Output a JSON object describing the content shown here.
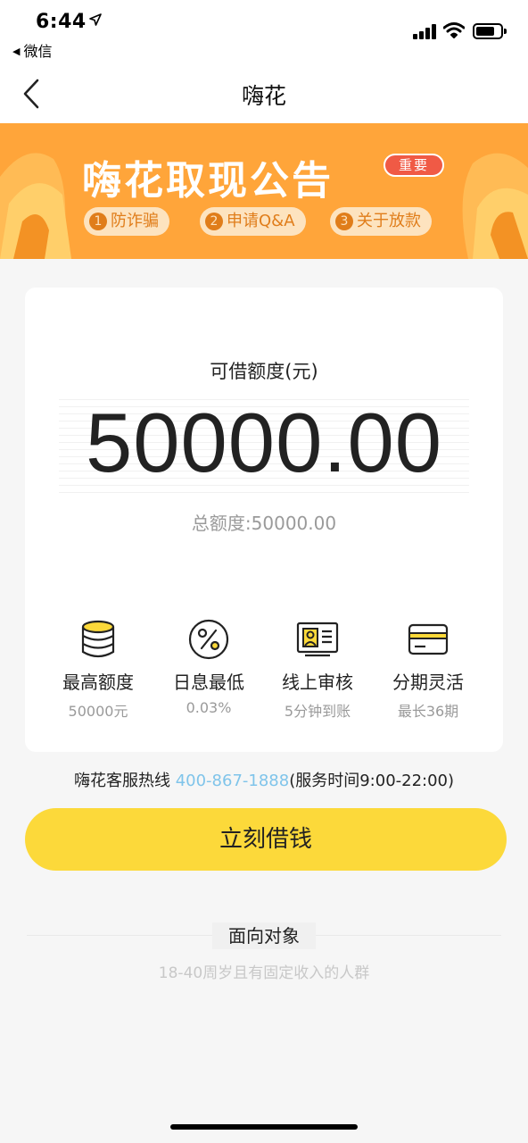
{
  "status_bar": {
    "time": "6:44",
    "back_app": "微信"
  },
  "nav": {
    "title": "嗨花"
  },
  "banner": {
    "title": "嗨花取现公告",
    "badge": "重要",
    "pills": [
      {
        "num": "1",
        "label": "防诈骗"
      },
      {
        "num": "2",
        "label": "申请Q&A"
      },
      {
        "num": "3",
        "label": "关于放款"
      }
    ],
    "bg_color": "#ffa53a"
  },
  "card": {
    "amount_label": "可借额度(元)",
    "amount": "50000.00",
    "total": "总额度:50000.00",
    "features": [
      {
        "icon": "coin-stack-icon",
        "title": "最高额度",
        "sub": "50000元"
      },
      {
        "icon": "percent-icon",
        "title": "日息最低",
        "sub": "0.03%"
      },
      {
        "icon": "id-card-icon",
        "title": "线上审核",
        "sub": "5分钟到账"
      },
      {
        "icon": "credit-card-icon",
        "title": "分期灵活",
        "sub": "最长36期"
      }
    ]
  },
  "hotline": {
    "label": "嗨花客服热线",
    "phone": "400-867-1888",
    "hours": "(服务时间9:00-22:00)"
  },
  "cta": {
    "label": "立刻借钱",
    "color": "#fcd93a"
  },
  "target": {
    "title": "面向对象",
    "desc": "18-40周岁且有固定收入的人群"
  }
}
